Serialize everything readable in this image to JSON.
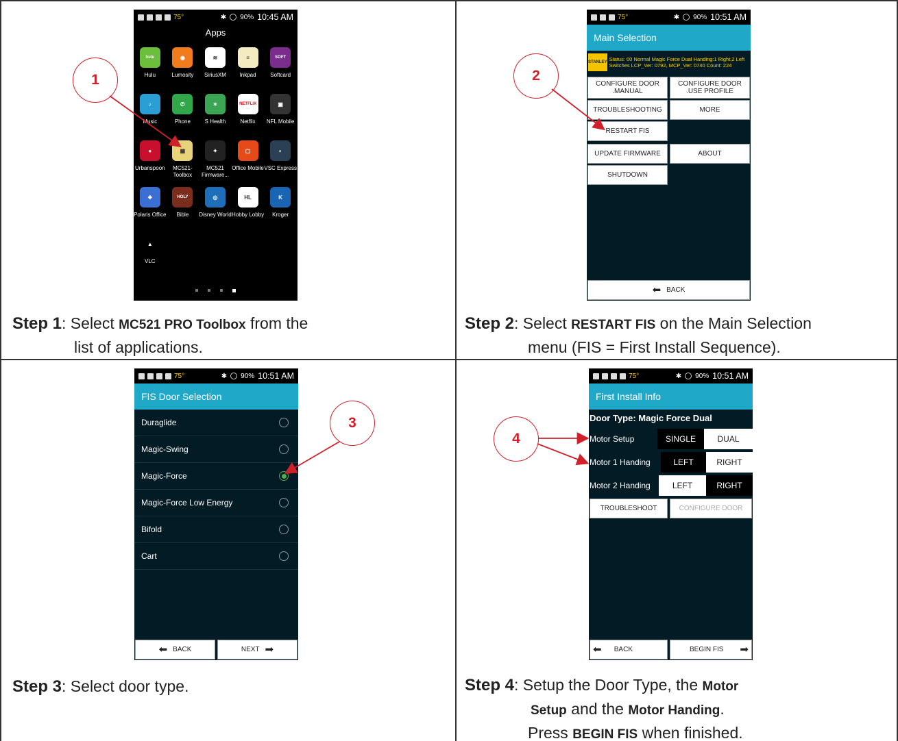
{
  "steps": [
    {
      "num": "1",
      "step_label": "Step 1",
      "caption_pre": ": Select ",
      "caption_bold": "MC521 PRO Toolbox",
      "caption_post": " from the",
      "caption_line2": "list of applications.",
      "phone": {
        "status_temp": "75°",
        "status_battery": "90%",
        "time": "10:45 AM",
        "title": "Apps",
        "apps": [
          {
            "label": "Hulu",
            "icon": "hulu-icon",
            "color": "#6cbf3b",
            "glyph": "hulu"
          },
          {
            "label": "Lumosity",
            "icon": "lumosity-icon",
            "color": "#f07c1d",
            "glyph": "◉"
          },
          {
            "label": "SiriusXM",
            "icon": "siriusxm-icon",
            "color": "#ffffff",
            "glyph": "≋"
          },
          {
            "label": "Inkpad",
            "icon": "inkpad-icon",
            "color": "#f4ecc0",
            "glyph": "≡"
          },
          {
            "label": "Softcard",
            "icon": "softcard-icon",
            "color": "#7b2d8e",
            "glyph": "SOFT"
          },
          {
            "label": "Music",
            "icon": "music-icon",
            "color": "#2a9fd6",
            "glyph": "♪"
          },
          {
            "label": "Phone",
            "icon": "phone-icon",
            "color": "#31a74a",
            "glyph": "✆"
          },
          {
            "label": "S Health",
            "icon": "s-health-icon",
            "color": "#3aa655",
            "glyph": "✶"
          },
          {
            "label": "Netflix",
            "icon": "netflix-icon",
            "color": "#ffffff",
            "glyph": "NETFLIX"
          },
          {
            "label": "NFL Mobile",
            "icon": "nfl-mobile-icon",
            "color": "#333333",
            "glyph": "▣"
          },
          {
            "label": "Urbanspoon",
            "icon": "urbanspoon-icon",
            "color": "#c8102e",
            "glyph": "●"
          },
          {
            "label": "MC521-Toolbox",
            "icon": "mc521-toolbox-icon",
            "color": "#e8d27a",
            "glyph": "▦"
          },
          {
            "label": "MC521 Firmware...",
            "icon": "mc521-firmware-icon",
            "color": "#222222",
            "glyph": "✦"
          },
          {
            "label": "Office Mobile",
            "icon": "office-mobile-icon",
            "color": "#e64a19",
            "glyph": "▢"
          },
          {
            "label": "VSC Express",
            "icon": "vsc-express-icon",
            "color": "#2b3f55",
            "glyph": "◐"
          },
          {
            "label": "Polaris Office",
            "icon": "polaris-office-icon",
            "color": "#3b6fd1",
            "glyph": "❖"
          },
          {
            "label": "Bible",
            "icon": "bible-icon",
            "color": "#7a2d1c",
            "glyph": "HOLY"
          },
          {
            "label": "Disney World",
            "icon": "disney-world-icon",
            "color": "#1c6fb8",
            "glyph": "◎"
          },
          {
            "label": "Hobby Lobby",
            "icon": "hobby-lobby-icon",
            "color": "#ffffff",
            "glyph": "HL"
          },
          {
            "label": "Kroger",
            "icon": "kroger-icon",
            "color": "#1a64b4",
            "glyph": "K"
          },
          {
            "label": "VLC",
            "icon": "vlc-icon",
            "color": "#000000",
            "glyph": "▲"
          }
        ]
      }
    },
    {
      "num": "2",
      "step_label": "Step 2",
      "caption_pre": ": Select ",
      "caption_bold": "RESTART FIS",
      "caption_post": " on the Main Selection",
      "caption_line2": "menu (FIS = First Install Sequence).",
      "phone": {
        "status_temp": "75°",
        "status_battery": "90%",
        "time": "10:51 AM",
        "title": "Main Selection",
        "logo": "STANLEY",
        "status_line": "Status: 00 Normal Magic Force Dual Handing:1 Right,2 Left Switches LCP_Ver: 0792, MCP_Ver: 0740 Count: 224",
        "buttons": {
          "configure_manual": "CONFIGURE DOOR .MANUAL",
          "configure_profile": "CONFIGURE DOOR .USE PROFILE",
          "troubleshooting": "TROUBLESHOOTING",
          "more": "MORE",
          "restart_fis": "RESTART FIS",
          "update_firmware": "UPDATE FIRMWARE",
          "about": "ABOUT",
          "shutdown": "SHUTDOWN",
          "back": "BACK"
        }
      }
    },
    {
      "num": "3",
      "step_label": "Step 3",
      "caption_post": ": Select door type.",
      "phone": {
        "status_temp": "75°",
        "status_battery": "90%",
        "time": "10:51 AM",
        "title": "FIS Door Selection",
        "options": [
          {
            "label": "Duraglide",
            "selected": false
          },
          {
            "label": "Magic-Swing",
            "selected": false
          },
          {
            "label": "Magic-Force",
            "selected": true
          },
          {
            "label": "Magic-Force Low Energy",
            "selected": false
          },
          {
            "label": "Bifold",
            "selected": false
          },
          {
            "label": "Cart",
            "selected": false
          }
        ],
        "back": "BACK",
        "next": "NEXT"
      }
    },
    {
      "num": "4",
      "step_label": "Step 4",
      "caption_pre": ": Setup the Door Type, the ",
      "caption_bold": "Motor",
      "caption_line2_bold": "Setup",
      "caption_line2_mid": " and the ",
      "caption_line2_bold2": "Motor Handing",
      "caption_line2_end": ".",
      "caption_line3_pre": "Press ",
      "caption_line3_bold": "BEGIN FIS",
      "caption_line3_end": " when finished.",
      "phone": {
        "status_temp": "75°",
        "status_battery": "90%",
        "time": "10:51 AM",
        "title": "First Install Info",
        "door_type": "Door Type: Magic Force Dual",
        "motor_setup": {
          "label": "Motor Setup",
          "a": "SINGLE",
          "b": "DUAL",
          "selected": "SINGLE"
        },
        "motor1": {
          "label": "Motor 1 Handing",
          "a": "LEFT",
          "b": "RIGHT",
          "selected": "LEFT"
        },
        "motor2": {
          "label": "Motor 2 Handing",
          "a": "LEFT",
          "b": "RIGHT",
          "selected": "RIGHT"
        },
        "troubleshoot": "TROUBLESHOOT",
        "configure_door": "CONFIGURE DOOR",
        "back": "BACK",
        "begin_fis": "BEGIN FIS"
      }
    }
  ],
  "colors": {
    "accent": "#1fa8c8",
    "callout": "#d0202a",
    "selected_radio": "#4caf50"
  }
}
